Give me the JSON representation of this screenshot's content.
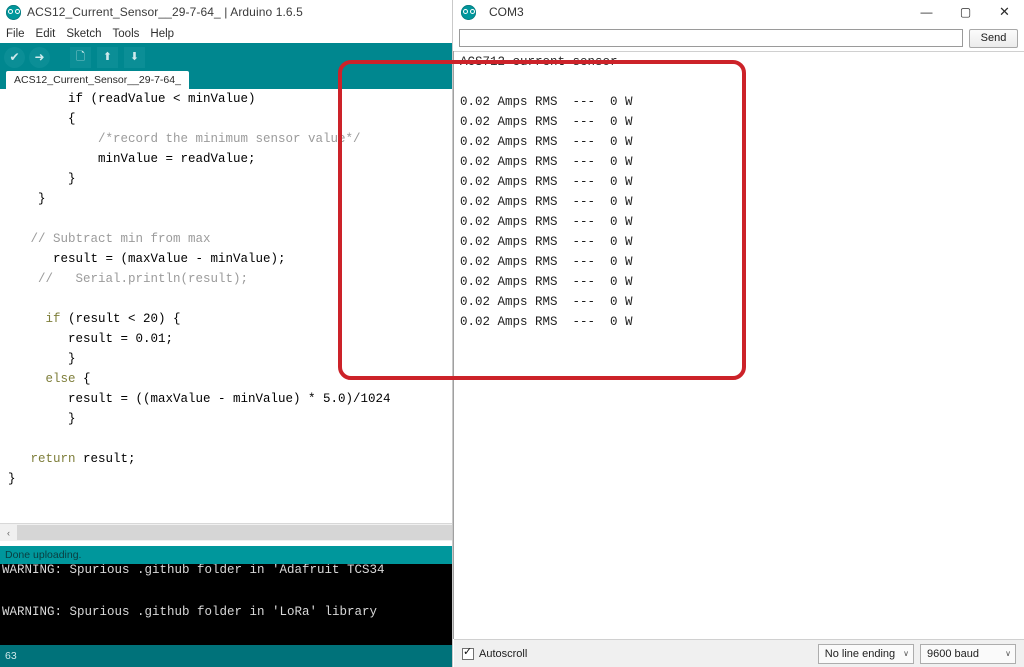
{
  "ide": {
    "window_title": "ACS12_Current_Sensor__29-7-64_ | Arduino 1.6.5",
    "logo_icon": "arduino-logo-icon",
    "menu": [
      "File",
      "Edit",
      "Sketch",
      "Tools",
      "Help"
    ],
    "toolbar": [
      {
        "name": "verify-button",
        "icon": "check-icon",
        "glyph": "✔"
      },
      {
        "name": "upload-button",
        "icon": "arrow-right-icon",
        "glyph": "➜"
      },
      {
        "name": "new-button",
        "icon": "new-file-icon",
        "glyph": "🗋"
      },
      {
        "name": "open-button",
        "icon": "arrow-up-icon",
        "glyph": "⬆"
      },
      {
        "name": "save-button",
        "icon": "arrow-down-icon",
        "glyph": "⬇"
      }
    ],
    "tab_label": "ACS12_Current_Sensor__29-7-64_",
    "code_lines": [
      {
        "indent": 8,
        "segments": [
          {
            "t": "if (readValue < minValue)",
            "c": "plain"
          }
        ]
      },
      {
        "indent": 8,
        "segments": [
          {
            "t": "{",
            "c": "plain"
          }
        ]
      },
      {
        "indent": 12,
        "segments": [
          {
            "t": "/*record the minimum sensor value*/",
            "c": "cmt"
          }
        ]
      },
      {
        "indent": 12,
        "segments": [
          {
            "t": "minValue = readValue;",
            "c": "plain"
          }
        ]
      },
      {
        "indent": 8,
        "segments": [
          {
            "t": "}",
            "c": "plain"
          }
        ]
      },
      {
        "indent": 4,
        "segments": [
          {
            "t": "}",
            "c": "plain"
          }
        ]
      },
      {
        "indent": 0,
        "segments": [
          {
            "t": "",
            "c": "plain"
          }
        ]
      },
      {
        "indent": 3,
        "segments": [
          {
            "t": "// Subtract min from max",
            "c": "cmt"
          }
        ]
      },
      {
        "indent": 6,
        "segments": [
          {
            "t": "result = (maxValue - minValue);",
            "c": "plain"
          }
        ]
      },
      {
        "indent": 4,
        "segments": [
          {
            "t": "//   Serial.println(result);",
            "c": "cmt"
          }
        ]
      },
      {
        "indent": 0,
        "segments": [
          {
            "t": "",
            "c": "plain"
          }
        ]
      },
      {
        "indent": 5,
        "segments": [
          {
            "t": "if",
            "c": "kw"
          },
          {
            "t": " (result < 20) {",
            "c": "plain"
          }
        ]
      },
      {
        "indent": 8,
        "segments": [
          {
            "t": "result = 0.01;",
            "c": "plain"
          }
        ]
      },
      {
        "indent": 8,
        "segments": [
          {
            "t": "}",
            "c": "plain"
          }
        ]
      },
      {
        "indent": 5,
        "segments": [
          {
            "t": "else",
            "c": "kw"
          },
          {
            "t": " {",
            "c": "plain"
          }
        ]
      },
      {
        "indent": 8,
        "segments": [
          {
            "t": "result = ((maxValue - minValue) * 5.0)/1024",
            "c": "plain"
          }
        ]
      },
      {
        "indent": 8,
        "segments": [
          {
            "t": "}",
            "c": "plain"
          }
        ]
      },
      {
        "indent": 0,
        "segments": [
          {
            "t": "",
            "c": "plain"
          }
        ]
      },
      {
        "indent": 3,
        "segments": [
          {
            "t": "return",
            "c": "kw"
          },
          {
            "t": " result;",
            "c": "plain"
          }
        ]
      },
      {
        "indent": 0,
        "segments": [
          {
            "t": "}",
            "c": "plain"
          }
        ]
      }
    ],
    "hscroll_left_arrow": "‹",
    "status_text": "Done uploading.",
    "console_lines": [
      "WARNING: Spurious .github folder in 'Adafruit TCS34",
      "",
      "WARNING: Spurious .github folder in 'LoRa' library"
    ],
    "line_number": "63"
  },
  "serial": {
    "window_title": "COM3",
    "logo_icon": "arduino-logo-icon",
    "window_buttons": [
      {
        "name": "minimize-button",
        "glyph": "—"
      },
      {
        "name": "maximize-button",
        "glyph": "▢"
      },
      {
        "name": "close-button",
        "glyph": "✕"
      }
    ],
    "input_value": "",
    "input_placeholder": "",
    "send_label": "Send",
    "output_header": "ACS712 current sensor",
    "output_lines": [
      "0.02 Amps RMS  ---  0 W",
      "0.02 Amps RMS  ---  0 W",
      "0.02 Amps RMS  ---  0 W",
      "0.02 Amps RMS  ---  0 W",
      "0.02 Amps RMS  ---  0 W",
      "0.02 Amps RMS  ---  0 W",
      "0.02 Amps RMS  ---  0 W",
      "0.02 Amps RMS  ---  0 W",
      "0.02 Amps RMS  ---  0 W",
      "0.02 Amps RMS  ---  0 W",
      "0.02 Amps RMS  ---  0 W",
      "0.02 Amps RMS  ---  0 W"
    ],
    "autoscroll_label": "Autoscroll",
    "autoscroll_checked": true,
    "line_ending_value": "No line ending",
    "baud_value": "9600 baud",
    "caret_glyph": "∨"
  },
  "annotation": {
    "name": "red-highlight-box",
    "color": "#cc2229"
  }
}
